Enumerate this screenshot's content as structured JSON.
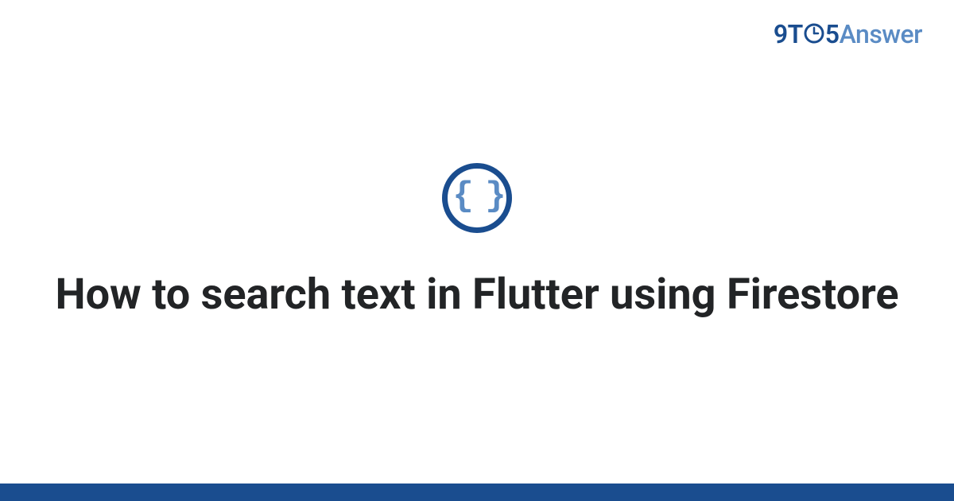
{
  "brand": {
    "prefix": "9T",
    "middle": "5",
    "suffix": "Answer"
  },
  "icon": {
    "glyph": "{ }",
    "name": "code-braces-icon"
  },
  "title": "How to search text in Flutter using Firestore",
  "colors": {
    "brand_dark": "#1a4d8f",
    "brand_light": "#5a8bc4",
    "text": "#222426"
  }
}
